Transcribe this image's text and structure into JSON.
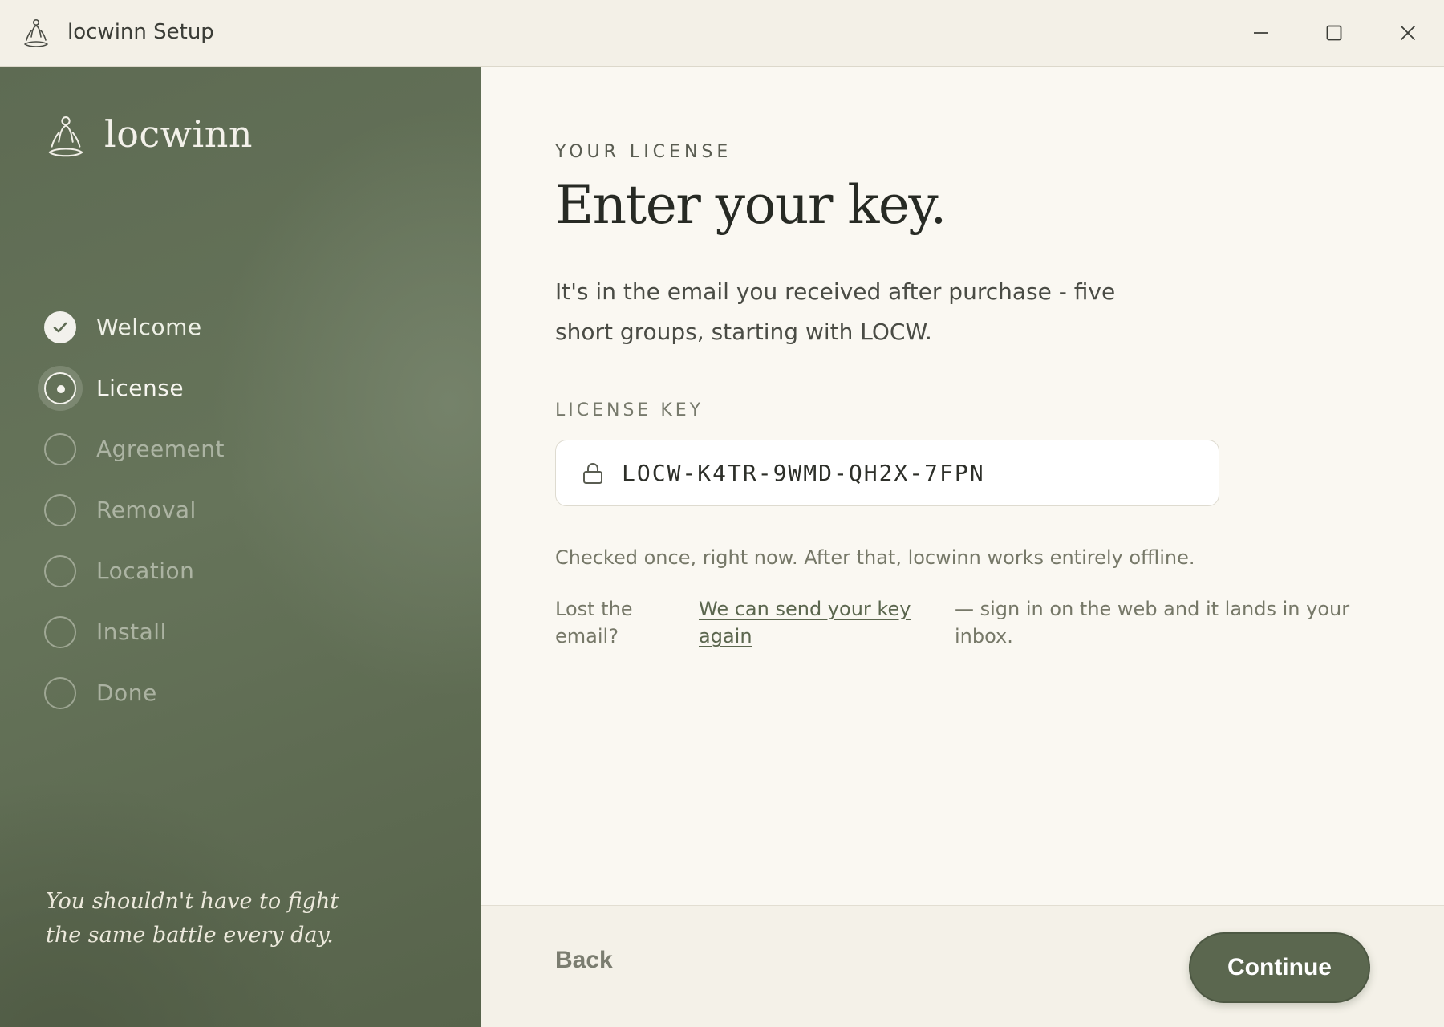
{
  "window": {
    "title": "locwinn Setup",
    "controls": [
      "minimize-icon",
      "maximize-icon",
      "close-icon"
    ]
  },
  "sidebar": {
    "brand": "locwinn",
    "steps": [
      {
        "label": "Welcome",
        "state": "done"
      },
      {
        "label": "License",
        "state": "current"
      },
      {
        "label": "Agreement",
        "state": "pending"
      },
      {
        "label": "Removal",
        "state": "pending"
      },
      {
        "label": "Location",
        "state": "pending"
      },
      {
        "label": "Install",
        "state": "pending"
      },
      {
        "label": "Done",
        "state": "pending"
      }
    ],
    "quote_line1": "You shouldn't have to fight",
    "quote_line2": "the same battle every day."
  },
  "main": {
    "eyebrow": "YOUR LICENSE",
    "heading": "Enter your key.",
    "intro": "It's in the email you received after purchase - five short groups, starting with LOCW.",
    "field_label": "LICENSE KEY",
    "license_key": "LOCW-K4TR-9WMD-QH2X-7FPN",
    "note": "Checked once, right now. After that, locwinn works entirely offline.",
    "lost_label": "Lost the email?",
    "resend_link": "We can send your key again",
    "lost_tail": "— sign in on the web and it lands in your inbox."
  },
  "footer": {
    "back_label": "Back",
    "continue_label": "Continue"
  },
  "colors": {
    "sidebar_green": "#66745a",
    "accent_button": "#5b674f",
    "background": "#faf8f2",
    "link": "#5b664e"
  }
}
